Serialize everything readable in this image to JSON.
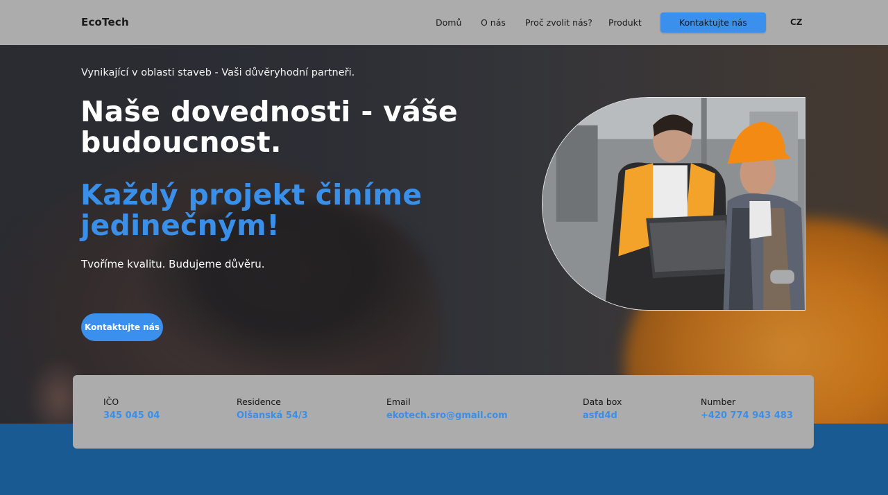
{
  "header": {
    "logo": "EcoTech",
    "nav": [
      "Domů",
      "O nás",
      "Proč zvolit nás?",
      "Produkt"
    ],
    "cta": "Kontaktujte nás",
    "lang": "CZ"
  },
  "hero": {
    "tagline": "Vynikající v oblasti staveb - Vaši důvěryhodní partneři.",
    "title": "Naše dovednosti - váše budoucnost.",
    "highlight": "Každý projekt činíme jedinečným!",
    "subtitle": "Tvoříme kvalitu. Budujeme důvěru.",
    "cta": "Kontaktujte nás"
  },
  "info": [
    {
      "label": "IČO",
      "value": "345 045 04"
    },
    {
      "label": "Residence",
      "value": "Olšanská 54/3"
    },
    {
      "label": "Email",
      "value": "ekotech.sro@gmail.com"
    },
    {
      "label": "Data box",
      "value": "asfd4d"
    },
    {
      "label": "Number",
      "value": "+420 774 943 483"
    }
  ],
  "colors": {
    "accent": "#3b8fed",
    "header_bg": "#acacac",
    "footer_band": "#1a5a92",
    "highlight_text": "#3a8fe9"
  }
}
